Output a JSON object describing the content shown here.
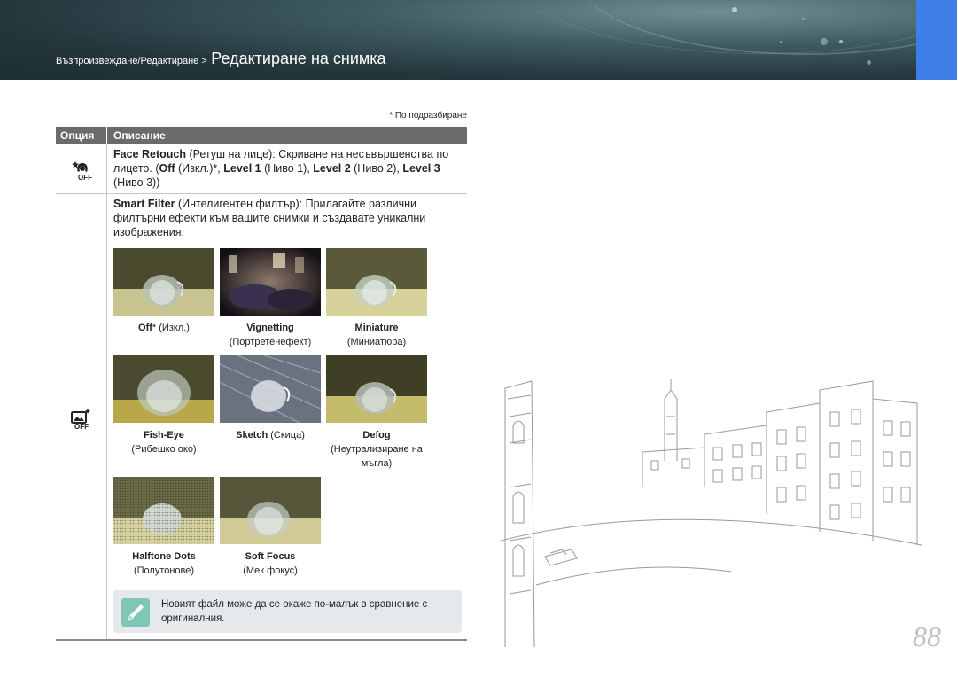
{
  "header": {
    "breadcrumb_prefix": "Възпроизвеждане/Редактиране >",
    "title": "Редактиране на снимка"
  },
  "table": {
    "default_note": "* По подразбиране",
    "col_option": "Опция",
    "col_description": "Описание",
    "rows": [
      {
        "icon": "face-retouch-off-icon",
        "desc": {
          "t1": "Face Retouch",
          "t2": " (Ретуш на лице): Скриване на несъвършенства по лицето. (",
          "t3": "Off",
          "t4": " (Изкл.)*, ",
          "t5": "Level 1",
          "t6": " (Ниво 1), ",
          "t7": "Level 2",
          "t8": " (Ниво 2), ",
          "t9": "Level 3",
          "t10": " (Ниво 3))"
        }
      },
      {
        "icon": "smart-filter-off-icon",
        "desc": {
          "t1": "Smart Filter",
          "t2": " (Интелигентен филтър): Прилагайте различни филтърни ефекти към вашите снимки и създавате уникални изображения."
        },
        "filters": [
          {
            "name": "Off",
            "extra": "* (Изкл.)",
            "sub": ""
          },
          {
            "name": "Vignetting",
            "extra": "",
            "sub": "(Портретенефект)"
          },
          {
            "name": "Miniature",
            "extra": "",
            "sub": "(Миниатюра)"
          },
          {
            "name": "Fish-Eye",
            "extra": "",
            "sub": "(Рибешко око)"
          },
          {
            "name": "Sketch",
            "extra": " (Скица)",
            "sub": ""
          },
          {
            "name": "Defog",
            "extra": "",
            "sub": "(Неутрализиране на мъгла)"
          },
          {
            "name": "Halftone Dots",
            "extra": "",
            "sub": "(Полутонове)"
          },
          {
            "name": "Soft Focus",
            "extra": "",
            "sub": "(Мек фокус)"
          }
        ]
      }
    ]
  },
  "note": {
    "icon": "pen-note-icon",
    "text": "Новият файл може да се окаже по-малък в сравнение с оригиналния."
  },
  "page_number": "88",
  "colors": {
    "accent_blue": "#3d7fe6",
    "table_header": "#6b6b6b",
    "note_bg": "#e6e9ec",
    "note_icon": "#7fc7b4"
  }
}
